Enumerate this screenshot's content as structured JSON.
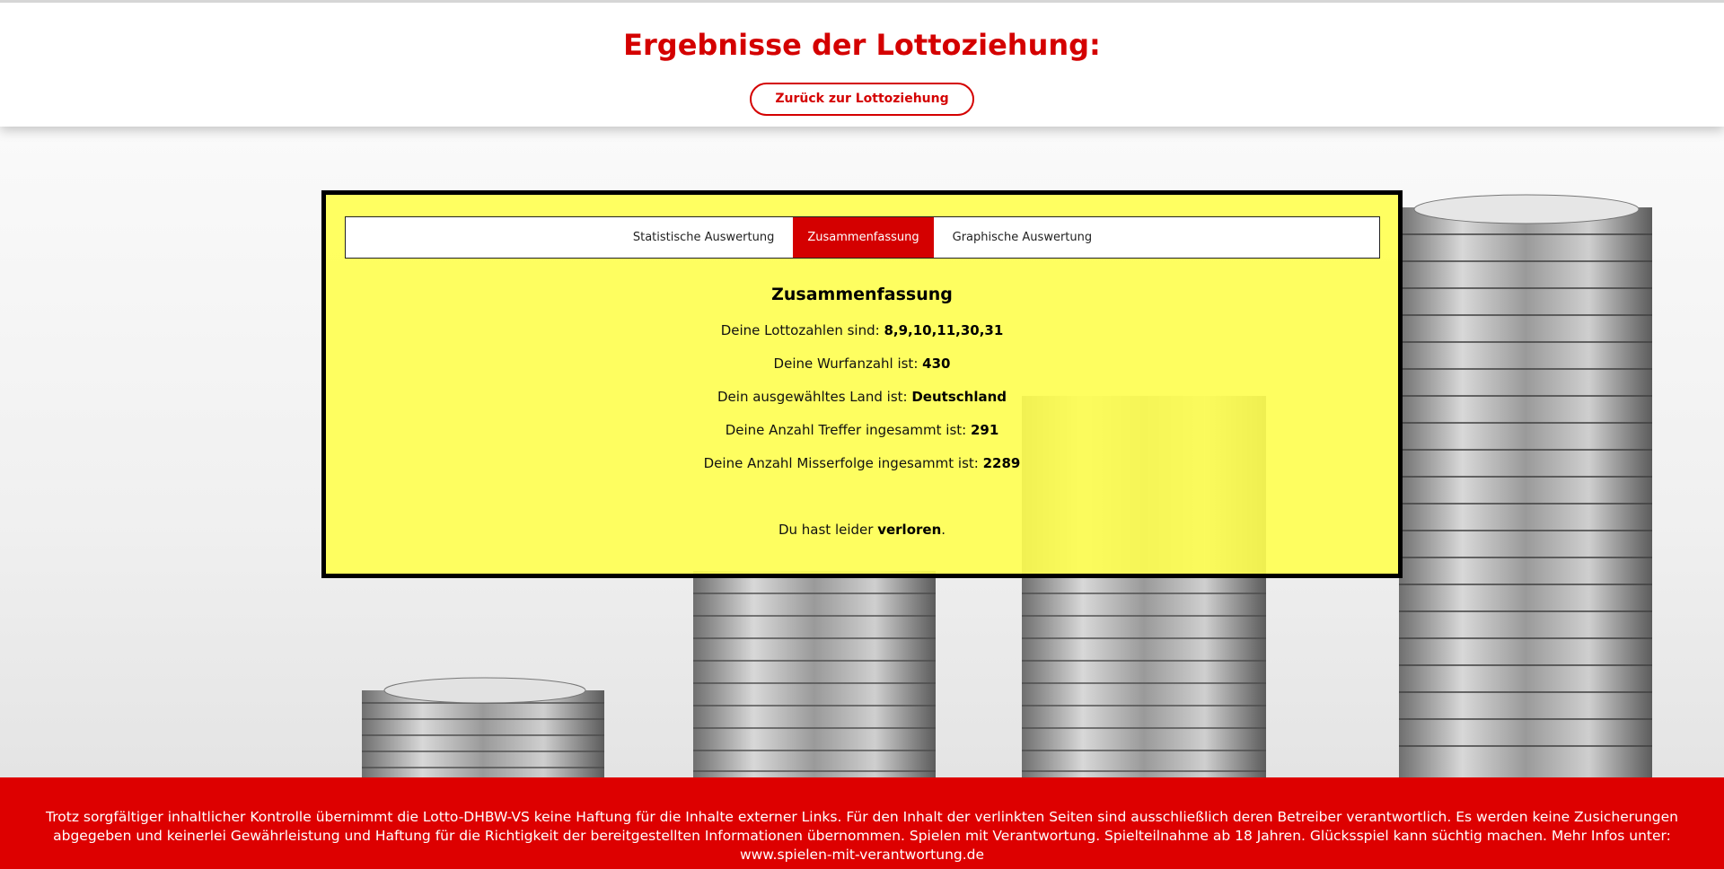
{
  "header": {
    "title": "Ergebnisse der Lottoziehung:",
    "back_label": "Zurück zur Lottoziehung"
  },
  "tabs": [
    {
      "label": "Statistische Auswertung",
      "active": false
    },
    {
      "label": "Zusammenfassung",
      "active": true
    },
    {
      "label": "Graphische Auswertung",
      "active": false
    }
  ],
  "summary": {
    "heading": "Zusammenfassung",
    "numbers_label": "Deine Lottozahlen sind:",
    "numbers_value": "8,9,10,11,30,31",
    "throws_label": "Deine Wurfanzahl ist:",
    "throws_value": "430",
    "country_label": "Dein ausgewähltes Land ist:",
    "country_value": "Deutschland",
    "hits_label": "Deine Anzahl Treffer ingesammt ist:",
    "hits_value": "291",
    "misses_label": "Deine Anzahl Misserfolge ingesammt ist:",
    "misses_value": "2289",
    "result_prefix": "Du hast leider",
    "result_value": "verloren",
    "result_suffix": "."
  },
  "footer": {
    "text": "Trotz sorgfältiger inhaltlicher Kontrolle übernimmt die Lotto-DHBW-VS keine Haftung für die Inhalte externer Links. Für den Inhalt der verlinkten Seiten sind ausschließlich deren Betreiber verantwortlich. Es werden keine Zusicherungen abgegeben und keinerlei Gewährleistung und Haftung für die Richtigkeit der bereitgestellten Informationen übernommen. Spielen mit Verantwortung. Spielteilnahme ab 18 Jahren. Glücksspiel kann süchtig machen. Mehr Infos unter: www.spielen-mit-verantwortung.de"
  },
  "colors": {
    "brand_red": "#d40000",
    "panel_yellow": "#ffff55",
    "footer_red": "#dd0000"
  }
}
